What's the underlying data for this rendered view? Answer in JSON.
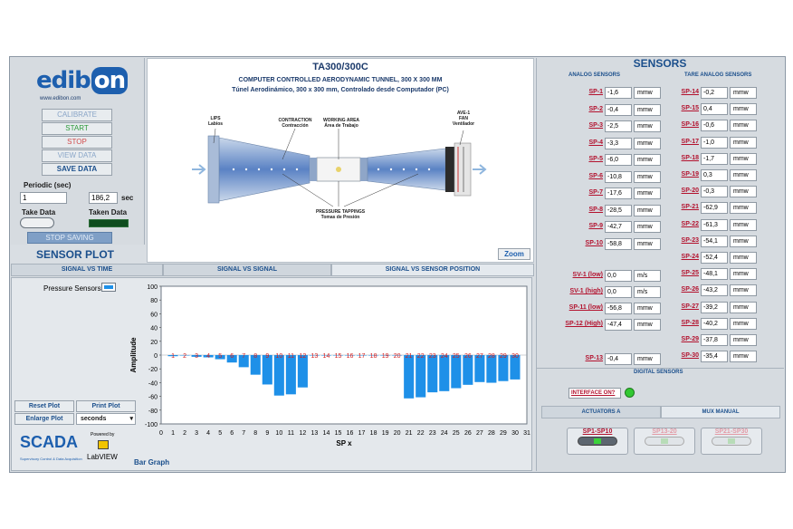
{
  "brand": {
    "logo_text_main": "edib",
    "logo_text_on": "on",
    "url": "www.edibon.com"
  },
  "controls": {
    "calibrate": "CALIBRATE",
    "start": "START",
    "stop": "STOP",
    "view_data": "VIEW DATA",
    "save_data": "SAVE DATA",
    "periodic_label": "Periodic (sec)",
    "periodic_value": "1",
    "elapsed_value": "186,2",
    "elapsed_unit": "sec",
    "take_data": "Take Data",
    "taken_data": "Taken Data",
    "stop_saving": "STOP SAVING"
  },
  "diagram": {
    "title": "TA300/300C",
    "subtitle_en": "COMPUTER CONTROLLED AERODYNAMIC TUNNEL, 300 X 300 MM",
    "subtitle_es": "Túnel Aerodinámico, 300 x 300 mm, Controlado desde Computador (PC)",
    "label_lips": "LIPS",
    "label_lips_es": "Labios",
    "label_contraction": "CONTRACTION",
    "label_contraction_es": "Contracción",
    "label_working": "WORKING AREA",
    "label_working_es": "Área de Trabajo",
    "label_ave": "AVE-1",
    "label_fan": "FAN",
    "label_fan_es": "Ventilador",
    "label_pressure": "PRESSURE TAPPINGS",
    "label_pressure_es": "Tomas de Presión",
    "zoom": "Zoom"
  },
  "plot": {
    "title": "SENSOR PLOT",
    "tabs": [
      "SIGNAL VS TIME",
      "SIGNAL VS SIGNAL",
      "SIGNAL VS SENSOR POSITION"
    ],
    "legend": "Pressure Sensors",
    "reset": "Reset Plot",
    "print": "Print Plot",
    "enlarge": "Enlarge Plot",
    "seconds": "seconds",
    "bar_graph": "Bar Graph",
    "scada_text": "SCADA",
    "scada_sub": "Supervisory Control & Data Acquisition",
    "powered_by": "Powered by",
    "labview": "LabVIEW"
  },
  "chart_data": {
    "type": "bar",
    "xlabel": "SP x",
    "ylabel": "Amplitude",
    "xlim": [
      0,
      31
    ],
    "ylim": [
      -100,
      100
    ],
    "yticks": [
      100,
      80,
      60,
      40,
      20,
      0,
      -20,
      -40,
      -60,
      -80,
      -100
    ],
    "xticks": [
      0,
      1,
      2,
      3,
      4,
      5,
      6,
      7,
      8,
      9,
      10,
      11,
      12,
      13,
      14,
      15,
      16,
      17,
      18,
      19,
      20,
      21,
      22,
      23,
      24,
      25,
      26,
      27,
      28,
      29,
      30,
      31
    ],
    "categories": [
      "1",
      "2",
      "3",
      "4",
      "5",
      "6",
      "7",
      "8",
      "9",
      "10",
      "11",
      "12",
      "13",
      "14",
      "15",
      "16",
      "17",
      "18",
      "19",
      "20",
      "21",
      "22",
      "23",
      "24",
      "25",
      "26",
      "27",
      "28",
      "29",
      "30"
    ],
    "values": [
      -1.6,
      -0.4,
      -2.5,
      -3.3,
      -6.0,
      -10.8,
      -17.6,
      -28.5,
      -42.7,
      -58.8,
      -57,
      -47,
      0,
      0,
      0,
      0,
      0,
      0,
      0,
      0,
      -62.9,
      -61.3,
      -54.1,
      -52.4,
      -48.1,
      -43.2,
      -39.2,
      -40.2,
      -37.8,
      -35.4
    ],
    "bar_color": "#1e90e8",
    "label_color": "#d41a1a"
  },
  "sensors": {
    "title": "SENSORS",
    "analog_header": "ANALOG SENSORS",
    "tare_header": "TARE ANALOG SENSORS",
    "left": [
      {
        "label": "SP-1",
        "value": "-1,6",
        "unit": "mmw"
      },
      {
        "label": "SP-2",
        "value": "-0,4",
        "unit": "mmw"
      },
      {
        "label": "SP-3",
        "value": "-2,5",
        "unit": "mmw"
      },
      {
        "label": "SP-4",
        "value": "-3,3",
        "unit": "mmw"
      },
      {
        "label": "SP-5",
        "value": "-6,0",
        "unit": "mmw"
      },
      {
        "label": "SP-6",
        "value": "-10,8",
        "unit": "mmw"
      },
      {
        "label": "SP-7",
        "value": "-17,6",
        "unit": "mmw"
      },
      {
        "label": "SP-8",
        "value": "-28,5",
        "unit": "mmw"
      },
      {
        "label": "SP-9",
        "value": "-42,7",
        "unit": "mmw"
      },
      {
        "label": "SP-10",
        "value": "-58,8",
        "unit": "mmw"
      }
    ],
    "right": [
      {
        "label": "SP-14",
        "value": "-0,2",
        "unit": "mmw"
      },
      {
        "label": "SP-15",
        "value": "0,4",
        "unit": "mmw"
      },
      {
        "label": "SP-16",
        "value": "-0,6",
        "unit": "mmw"
      },
      {
        "label": "SP-17",
        "value": "-1,0",
        "unit": "mmw"
      },
      {
        "label": "SP-18",
        "value": "-1,7",
        "unit": "mmw"
      },
      {
        "label": "SP-19",
        "value": "0,3",
        "unit": "mmw"
      },
      {
        "label": "SP-20",
        "value": "-0,3",
        "unit": "mmw"
      },
      {
        "label": "SP-21",
        "value": "-62,9",
        "unit": "mmw"
      },
      {
        "label": "SP-22",
        "value": "-61,3",
        "unit": "mmw"
      },
      {
        "label": "SP-23",
        "value": "-54,1",
        "unit": "mmw"
      },
      {
        "label": "SP-24",
        "value": "-52,4",
        "unit": "mmw"
      },
      {
        "label": "SP-25",
        "value": "-48,1",
        "unit": "mmw"
      },
      {
        "label": "SP-26",
        "value": "-43,2",
        "unit": "mmw"
      },
      {
        "label": "SP-27",
        "value": "-39,2",
        "unit": "mmw"
      },
      {
        "label": "SP-28",
        "value": "-40,2",
        "unit": "mmw"
      },
      {
        "label": "SP-29",
        "value": "-37,8",
        "unit": "mmw"
      },
      {
        "label": "SP-30",
        "value": "-35,4",
        "unit": "mmw"
      }
    ],
    "extra": [
      {
        "label": "SV-1 (low)",
        "value": "0,0",
        "unit": "m/s"
      },
      {
        "label": "SV-1 (high)",
        "value": "0,0",
        "unit": "m/s"
      },
      {
        "label": "SP-11 (low)",
        "value": "-56,8",
        "unit": "mmw"
      },
      {
        "label": "SP-12 (High)",
        "value": "-47,4",
        "unit": "mmw"
      },
      {
        "label": "SP-13",
        "value": "-0,4",
        "unit": "mmw"
      }
    ],
    "digital_header": "DIGITAL SENSORS",
    "interface_label": "INTERFACE ON?",
    "actuators_tab": "ACTUATORS A",
    "mux_tab": "MUX MANUAL",
    "act1": "SP1-SP10",
    "act2": "SP13-20",
    "act3": "SP21-SP30"
  }
}
